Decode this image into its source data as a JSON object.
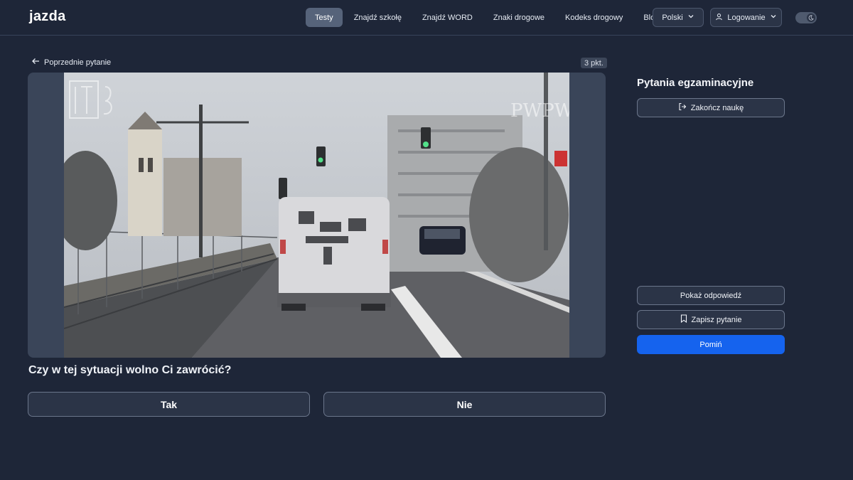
{
  "header": {
    "logo_text": "jazda",
    "nav": [
      "Testy",
      "Znajdź szkołę",
      "Znajdź WORD",
      "Znaki drogowe",
      "Kodeks drogowy",
      "Blog"
    ],
    "active_nav": "Testy",
    "language": "Polski",
    "login": "Logowanie",
    "theme_toggle_icon": "moon-icon"
  },
  "question_area": {
    "prev_label": "Poprzednie pytanie",
    "points": "3 pkt.",
    "question": "Czy w tej sytuacji wolno Ci zawrócić?",
    "answers": [
      "Tak",
      "Nie"
    ],
    "media_watermarks": [
      "PWPW"
    ]
  },
  "sidebar": {
    "title": "Pytania egzaminacyjne",
    "end_label": "Zakończ naukę",
    "show_answer": "Pokaż odpowiedź",
    "save_question": "Zapisz pytanie",
    "skip": "Pomiń"
  },
  "colors": {
    "background": "#1e2638",
    "accent": "#1563ee",
    "active_nav": "#56637a"
  }
}
